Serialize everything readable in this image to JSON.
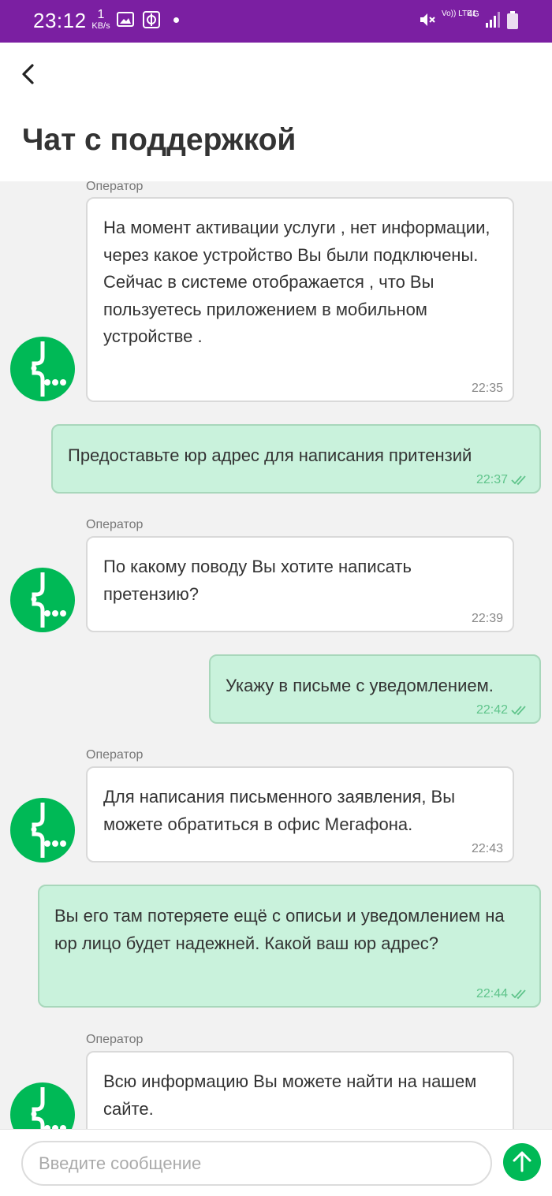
{
  "status_bar": {
    "time": "23:12",
    "net_speed_value": "1",
    "net_speed_unit": "KB/s",
    "volte": "Vo)) LTE1",
    "network": "4G"
  },
  "header": {
    "title": "Чат с поддержкой"
  },
  "chat": {
    "operator_label": "Оператор",
    "messages": [
      {
        "from": "operator",
        "text": "На момент активации услуги , нет информации, через какое устройство Вы были подключены.\nСейчас в системе отображается , что Вы пользуетесь приложением в мобильном устройстве .",
        "time": "22:35"
      },
      {
        "from": "user",
        "text": "Предоставьте юр адрес для написания притензий",
        "time": "22:37"
      },
      {
        "from": "operator",
        "text": "По какому поводу Вы хотите написать претензию?",
        "time": "22:39"
      },
      {
        "from": "user",
        "text": "Укажу в письме с уведомлением.",
        "time": "22:42"
      },
      {
        "from": "operator",
        "text": "Для написания письменного заявления, Вы можете обратиться в офис Мегафона.",
        "time": "22:43"
      },
      {
        "from": "user",
        "text": "Вы его там потеряете ещё с описьи и уведомлением на юр лицо будет надежней. Какой ваш юр адрес?",
        "time": "22:44"
      },
      {
        "from": "operator",
        "text": "Всю информацию Вы можете найти на нашем сайте.",
        "time": ""
      }
    ]
  },
  "composer": {
    "placeholder": "Введите сообщение"
  },
  "colors": {
    "status_bar": "#7b1fa2",
    "brand_green": "#00b956",
    "user_bubble": "#c9f2dc"
  }
}
